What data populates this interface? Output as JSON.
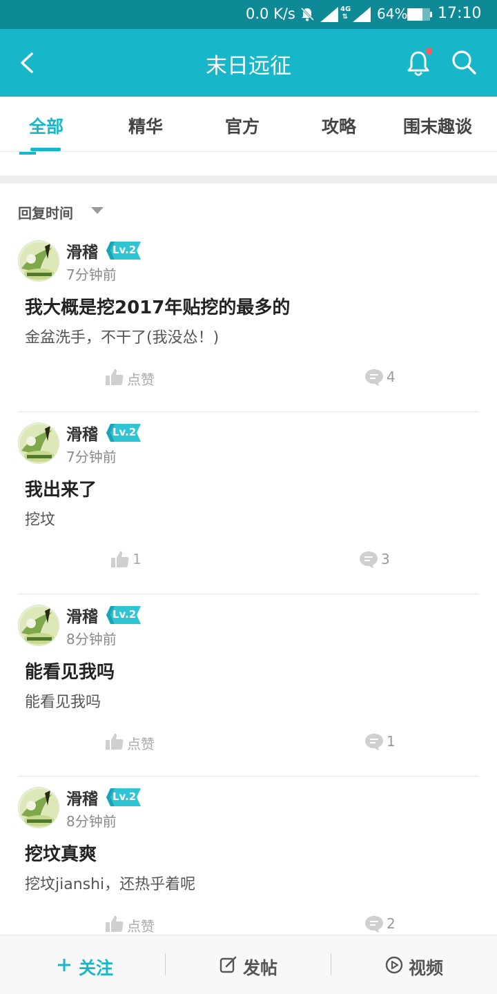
{
  "status_bar": {
    "net_speed": "0.0 K/s",
    "network": "4G",
    "battery": "64%",
    "time": "17:10"
  },
  "header": {
    "title": "末日远征",
    "icons": [
      "back-icon",
      "bell-icon",
      "search-icon"
    ],
    "notification_dot_color": "#ff5a5a"
  },
  "tabs": [
    {
      "label": "全部",
      "active": true
    },
    {
      "label": "精华",
      "active": false
    },
    {
      "label": "官方",
      "active": false
    },
    {
      "label": "攻略",
      "active": false
    },
    {
      "label": "围末趣谈",
      "active": false
    }
  ],
  "sort": {
    "label": "回复时间"
  },
  "posts": [
    {
      "author": "滑稽",
      "level": "Lv.2",
      "time": "7分钟前",
      "title": "我大概是挖2017年贴挖的最多的",
      "body": "金盆洗手，不干了(我没怂！)",
      "likes": "点赞",
      "comments": "4"
    },
    {
      "author": "滑稽",
      "level": "Lv.2",
      "time": "7分钟前",
      "title": "我出来了",
      "body": "挖坟",
      "likes": "1",
      "comments": "3"
    },
    {
      "author": "滑稽",
      "level": "Lv.2",
      "time": "8分钟前",
      "title": "能看见我吗",
      "body": "能看见我吗",
      "likes": "点赞",
      "comments": "1"
    },
    {
      "author": "滑稽",
      "level": "Lv.2",
      "time": "8分钟前",
      "title": "挖坟真爽",
      "body": "挖坟jianshi，还热乎着呢",
      "likes": "点赞",
      "comments": "2"
    }
  ],
  "bottom_bar": {
    "follow": "关注",
    "post": "发帖",
    "video": "视频"
  },
  "colors": {
    "accent": "#17b6c8",
    "status_bar": "#0e8a96",
    "level_badge": "#2ec4d4"
  }
}
